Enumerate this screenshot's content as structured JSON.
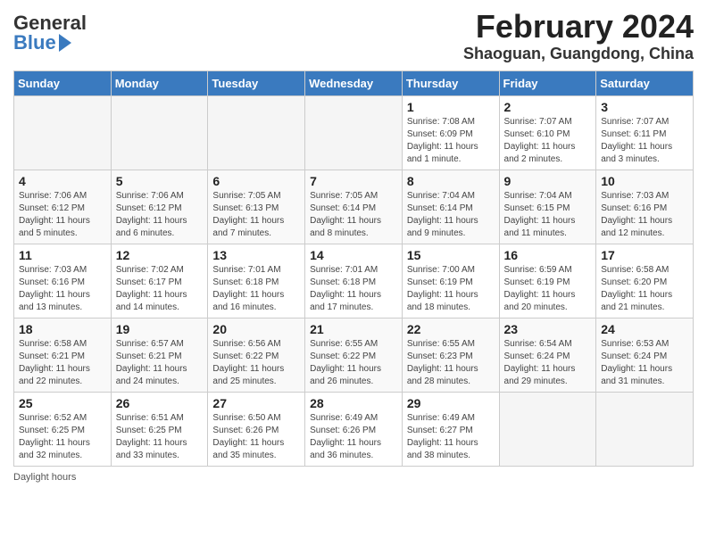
{
  "header": {
    "logo_general": "General",
    "logo_blue": "Blue",
    "month_title": "February 2024",
    "location": "Shaoguan, Guangdong, China"
  },
  "days_of_week": [
    "Sunday",
    "Monday",
    "Tuesday",
    "Wednesday",
    "Thursday",
    "Friday",
    "Saturday"
  ],
  "weeks": [
    [
      {
        "num": "",
        "info": ""
      },
      {
        "num": "",
        "info": ""
      },
      {
        "num": "",
        "info": ""
      },
      {
        "num": "",
        "info": ""
      },
      {
        "num": "1",
        "info": "Sunrise: 7:08 AM\nSunset: 6:09 PM\nDaylight: 11 hours\nand 1 minute."
      },
      {
        "num": "2",
        "info": "Sunrise: 7:07 AM\nSunset: 6:10 PM\nDaylight: 11 hours\nand 2 minutes."
      },
      {
        "num": "3",
        "info": "Sunrise: 7:07 AM\nSunset: 6:11 PM\nDaylight: 11 hours\nand 3 minutes."
      }
    ],
    [
      {
        "num": "4",
        "info": "Sunrise: 7:06 AM\nSunset: 6:12 PM\nDaylight: 11 hours\nand 5 minutes."
      },
      {
        "num": "5",
        "info": "Sunrise: 7:06 AM\nSunset: 6:12 PM\nDaylight: 11 hours\nand 6 minutes."
      },
      {
        "num": "6",
        "info": "Sunrise: 7:05 AM\nSunset: 6:13 PM\nDaylight: 11 hours\nand 7 minutes."
      },
      {
        "num": "7",
        "info": "Sunrise: 7:05 AM\nSunset: 6:14 PM\nDaylight: 11 hours\nand 8 minutes."
      },
      {
        "num": "8",
        "info": "Sunrise: 7:04 AM\nSunset: 6:14 PM\nDaylight: 11 hours\nand 9 minutes."
      },
      {
        "num": "9",
        "info": "Sunrise: 7:04 AM\nSunset: 6:15 PM\nDaylight: 11 hours\nand 11 minutes."
      },
      {
        "num": "10",
        "info": "Sunrise: 7:03 AM\nSunset: 6:16 PM\nDaylight: 11 hours\nand 12 minutes."
      }
    ],
    [
      {
        "num": "11",
        "info": "Sunrise: 7:03 AM\nSunset: 6:16 PM\nDaylight: 11 hours\nand 13 minutes."
      },
      {
        "num": "12",
        "info": "Sunrise: 7:02 AM\nSunset: 6:17 PM\nDaylight: 11 hours\nand 14 minutes."
      },
      {
        "num": "13",
        "info": "Sunrise: 7:01 AM\nSunset: 6:18 PM\nDaylight: 11 hours\nand 16 minutes."
      },
      {
        "num": "14",
        "info": "Sunrise: 7:01 AM\nSunset: 6:18 PM\nDaylight: 11 hours\nand 17 minutes."
      },
      {
        "num": "15",
        "info": "Sunrise: 7:00 AM\nSunset: 6:19 PM\nDaylight: 11 hours\nand 18 minutes."
      },
      {
        "num": "16",
        "info": "Sunrise: 6:59 AM\nSunset: 6:19 PM\nDaylight: 11 hours\nand 20 minutes."
      },
      {
        "num": "17",
        "info": "Sunrise: 6:58 AM\nSunset: 6:20 PM\nDaylight: 11 hours\nand 21 minutes."
      }
    ],
    [
      {
        "num": "18",
        "info": "Sunrise: 6:58 AM\nSunset: 6:21 PM\nDaylight: 11 hours\nand 22 minutes."
      },
      {
        "num": "19",
        "info": "Sunrise: 6:57 AM\nSunset: 6:21 PM\nDaylight: 11 hours\nand 24 minutes."
      },
      {
        "num": "20",
        "info": "Sunrise: 6:56 AM\nSunset: 6:22 PM\nDaylight: 11 hours\nand 25 minutes."
      },
      {
        "num": "21",
        "info": "Sunrise: 6:55 AM\nSunset: 6:22 PM\nDaylight: 11 hours\nand 26 minutes."
      },
      {
        "num": "22",
        "info": "Sunrise: 6:55 AM\nSunset: 6:23 PM\nDaylight: 11 hours\nand 28 minutes."
      },
      {
        "num": "23",
        "info": "Sunrise: 6:54 AM\nSunset: 6:24 PM\nDaylight: 11 hours\nand 29 minutes."
      },
      {
        "num": "24",
        "info": "Sunrise: 6:53 AM\nSunset: 6:24 PM\nDaylight: 11 hours\nand 31 minutes."
      }
    ],
    [
      {
        "num": "25",
        "info": "Sunrise: 6:52 AM\nSunset: 6:25 PM\nDaylight: 11 hours\nand 32 minutes."
      },
      {
        "num": "26",
        "info": "Sunrise: 6:51 AM\nSunset: 6:25 PM\nDaylight: 11 hours\nand 33 minutes."
      },
      {
        "num": "27",
        "info": "Sunrise: 6:50 AM\nSunset: 6:26 PM\nDaylight: 11 hours\nand 35 minutes."
      },
      {
        "num": "28",
        "info": "Sunrise: 6:49 AM\nSunset: 6:26 PM\nDaylight: 11 hours\nand 36 minutes."
      },
      {
        "num": "29",
        "info": "Sunrise: 6:49 AM\nSunset: 6:27 PM\nDaylight: 11 hours\nand 38 minutes."
      },
      {
        "num": "",
        "info": ""
      },
      {
        "num": "",
        "info": ""
      }
    ]
  ],
  "footer": {
    "daylight_label": "Daylight hours"
  }
}
